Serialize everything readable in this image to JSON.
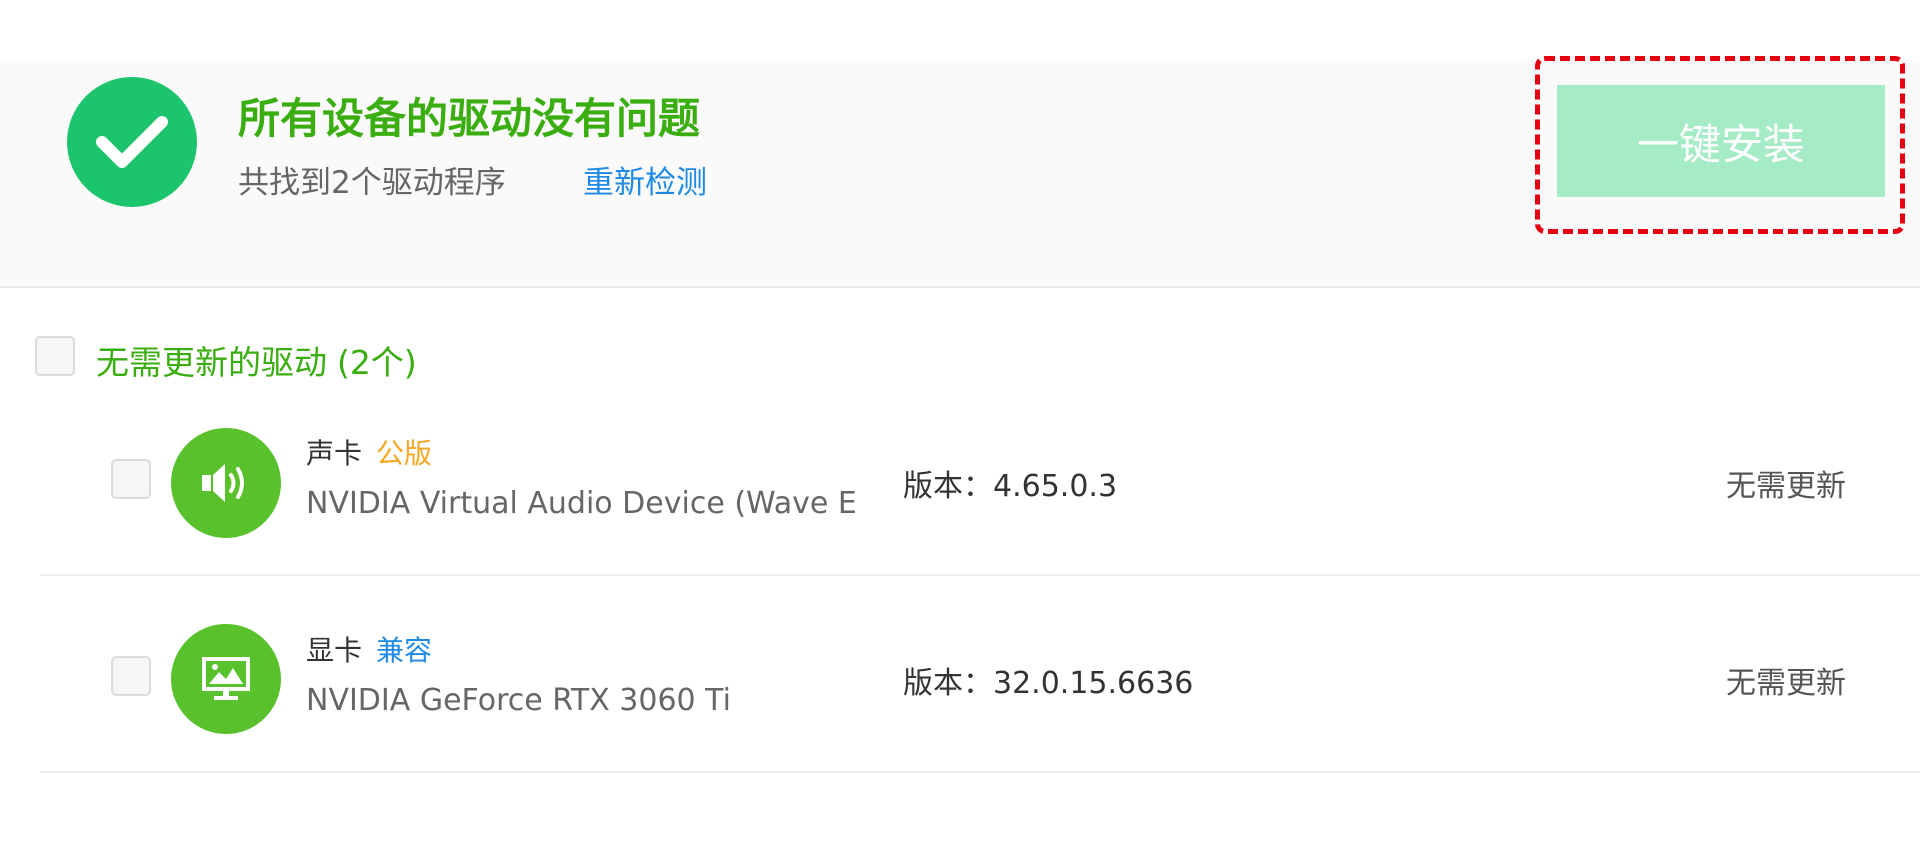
{
  "header": {
    "title": "所有设备的驱动没有问题",
    "found_text": "共找到2个驱动程序",
    "rescan_label": "重新检测",
    "install_button_label": "一键安装"
  },
  "section": {
    "label": "无需更新的驱动",
    "count": "(2个)"
  },
  "drivers": [
    {
      "type": "声卡",
      "tag": "公版",
      "tag_color": "#f5a623",
      "name": "NVIDIA Virtual Audio Device (Wave E",
      "version": "版本：4.65.0.3",
      "status": "无需更新",
      "icon": "speaker-icon"
    },
    {
      "type": "显卡",
      "tag": "兼容",
      "tag_color": "#1e8ae6",
      "name": "NVIDIA GeForce RTX 3060 Ti",
      "version": "版本：32.0.15.6636",
      "status": "无需更新",
      "icon": "monitor-icon"
    }
  ],
  "colors": {
    "success_green": "#1cc46d",
    "title_green": "#3aae10",
    "device_icon_green": "#59c12b",
    "link_blue": "#1e8ae6",
    "install_button_bg": "#a5ebc5",
    "highlight_red": "#e50012"
  }
}
